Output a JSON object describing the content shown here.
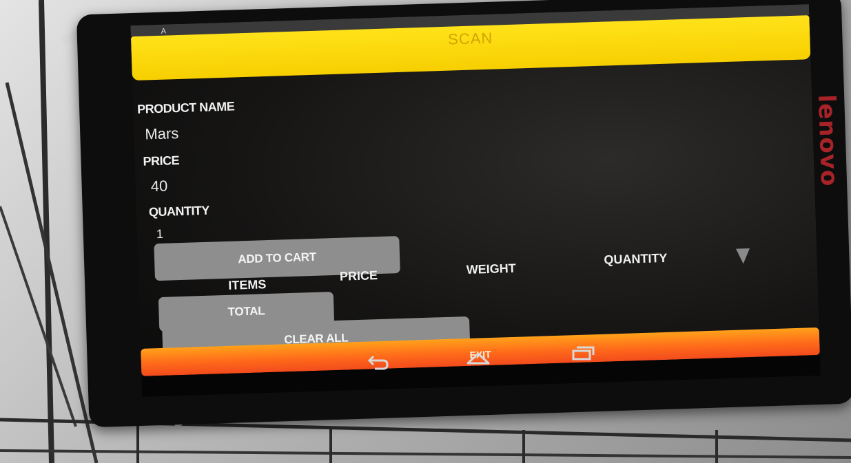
{
  "app": {
    "status_text": "A",
    "header_title": "SCAN"
  },
  "form": {
    "product_name_label": "PRODUCT NAME",
    "product_name_value": "Mars",
    "price_label": "PRICE",
    "price_value": "40",
    "quantity_label": "QUANTITY",
    "quantity_value": "1"
  },
  "buttons": {
    "add_to_cart": "ADD TO CART",
    "total": "TOTAL",
    "clear_all": "CLEAR  ALL",
    "exit": "EXIT"
  },
  "cart_table": {
    "headers": [
      "ITEMS",
      "PRICE",
      "WEIGHT",
      "QUANTITY"
    ]
  },
  "device": {
    "brand": "lenovo"
  },
  "icons": {
    "back": "back-icon",
    "home": "home-icon",
    "recents": "recents-icon",
    "dropdown": "dropdown-arrow-icon"
  },
  "colors": {
    "header_yellow": "#f7cf00",
    "exit_orange": "#ff6a1a",
    "button_gray": "#8e8e8e",
    "screen_bg": "#161514",
    "brand_red": "#c2272d"
  }
}
